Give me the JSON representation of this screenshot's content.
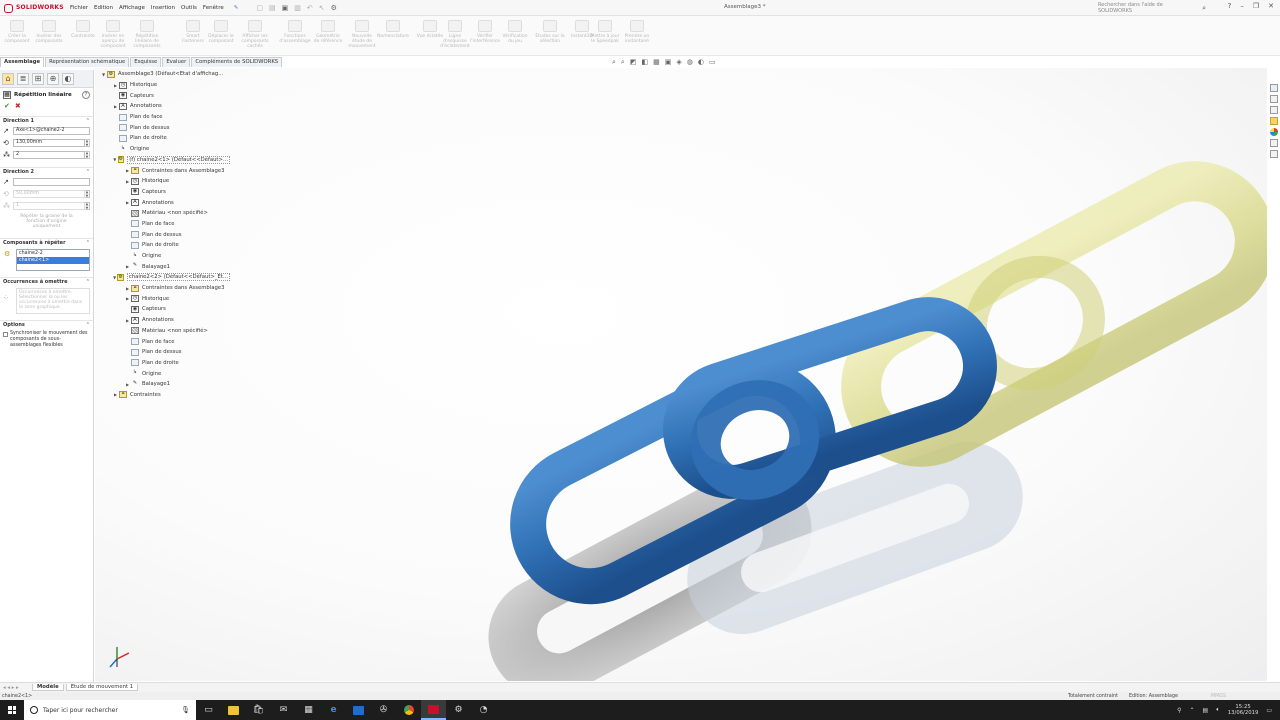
{
  "app": {
    "logo_text": "SOLIDWORKS",
    "menus": [
      "Fichier",
      "Edition",
      "Affichage",
      "Insertion",
      "Outils",
      "Fenêtre"
    ],
    "document_title": "Assemblage3 *",
    "search_placeholder": "Rechercher dans l'aide de SOLIDWORKS"
  },
  "command_manager": [
    "Créer la composant",
    "Insérer des composants",
    "Contrainte",
    "Insérer en aperçu de composant",
    "Répétition linéaire de composants",
    "Smart Fasteners",
    "Déplacer le composant",
    "Afficher les composants cachés",
    "Fonctions d'assemblage",
    "Géométrie de référence",
    "Nouvelle étude de mouvement",
    "Nomenclature",
    "Vue éclatée",
    "Ligne d'esquisse d'éclatement",
    "Vérifier l'interférence",
    "Vérification du jeu",
    "Etudes sur la sélection",
    "Instant3D",
    "Mettre à jour le Speedpak",
    "Prendre un instantané"
  ],
  "ribbon_tabs": [
    "Assemblage",
    "Représentation schématique",
    "Esquisse",
    "Evaluer",
    "Compléments de SOLIDWORKS"
  ],
  "property_manager": {
    "title": "Répétition linéaire",
    "direction1": {
      "heading": "Direction 1",
      "direction_ref": "Axe<1>@chaine2-2",
      "spacing": "130,00mm",
      "instances": "2"
    },
    "direction2": {
      "heading": "Direction 2",
      "direction_ref": "",
      "spacing": "50,00mm",
      "instances": "1",
      "note": "Répéter la graine de la fonction d'origine uniquement"
    },
    "components": {
      "heading": "Composants à répéter",
      "items": [
        "chaine2-2",
        "chaine2<1>"
      ]
    },
    "skip": {
      "heading": "Occurrences à omettre",
      "note": "Occurrences à omettre. Sélectionner la ou les occurrences à omettre dans la zone graphique."
    },
    "options": {
      "heading": "Options",
      "sync_label": "Synchroniser le mouvement des composants de sous-assemblages flexibles"
    }
  },
  "feature_tree": [
    {
      "label": "Assemblage3  (Défaut<Etat d'affichag...",
      "icon": "assembly",
      "expanded": true,
      "level": 0
    },
    {
      "label": "Historique",
      "icon": "history",
      "expander": true,
      "level": 1
    },
    {
      "label": "Capteurs",
      "icon": "sensors",
      "level": 1
    },
    {
      "label": "Annotations",
      "icon": "annotations",
      "expander": true,
      "level": 1
    },
    {
      "label": "Plan de face",
      "icon": "plane",
      "level": 1
    },
    {
      "label": "Plan de dessus",
      "icon": "plane",
      "level": 1
    },
    {
      "label": "Plan de droite",
      "icon": "plane",
      "level": 1
    },
    {
      "label": "Origine",
      "icon": "origin",
      "level": 1
    },
    {
      "label": "(f) chaine2<1> (Défaut<<Défaut>...",
      "icon": "part",
      "expanded": true,
      "boxed": true,
      "level": 1
    },
    {
      "label": "Contraintes dans Assemblage3",
      "icon": "mates",
      "expander": true,
      "level": 2
    },
    {
      "label": "Historique",
      "icon": "history",
      "expander": true,
      "level": 2
    },
    {
      "label": "Capteurs",
      "icon": "sensors",
      "level": 2
    },
    {
      "label": "Annotations",
      "icon": "annotations",
      "expander": true,
      "level": 2
    },
    {
      "label": "Matériau <non spécifié>",
      "icon": "material",
      "level": 2
    },
    {
      "label": "Plan de face",
      "icon": "plane",
      "level": 2
    },
    {
      "label": "Plan de dessus",
      "icon": "plane",
      "level": 2
    },
    {
      "label": "Plan de droite",
      "icon": "plane",
      "level": 2
    },
    {
      "label": "Origine",
      "icon": "origin",
      "level": 2
    },
    {
      "label": "Balayage1",
      "icon": "sweep",
      "expander": true,
      "level": 2
    },
    {
      "label": "chaine2<2> (Défaut<<Défaut>_Et...",
      "icon": "part",
      "expanded": true,
      "boxed": true,
      "level": 1
    },
    {
      "label": "Contraintes dans Assemblage3",
      "icon": "mates",
      "expander": true,
      "level": 2
    },
    {
      "label": "Historique",
      "icon": "history",
      "expander": true,
      "level": 2
    },
    {
      "label": "Capteurs",
      "icon": "sensors",
      "level": 2
    },
    {
      "label": "Annotations",
      "icon": "annotations",
      "expander": true,
      "level": 2
    },
    {
      "label": "Matériau <non spécifié>",
      "icon": "material",
      "level": 2
    },
    {
      "label": "Plan de face",
      "icon": "plane",
      "level": 2
    },
    {
      "label": "Plan de dessus",
      "icon": "plane",
      "level": 2
    },
    {
      "label": "Plan de droite",
      "icon": "plane",
      "level": 2
    },
    {
      "label": "Origine",
      "icon": "origin",
      "level": 2
    },
    {
      "label": "Balayage1",
      "icon": "sweep",
      "expander": true,
      "level": 2
    },
    {
      "label": "Contraintes",
      "icon": "mates",
      "expander": true,
      "level": 1
    }
  ],
  "model_tabs": [
    "Modèle",
    "Etude de mouvement 1"
  ],
  "status": {
    "selection": "chaine2<1>",
    "constraint": "Totalement contraint",
    "mode": "Edition: Assemblage",
    "units": "MMGS"
  },
  "taskbar": {
    "search_placeholder": "Taper ici pour rechercher",
    "time": "15:25",
    "date": "13/06/2019"
  },
  "colors": {
    "link_blue": "#2f6fb4",
    "link_yellow": "#d8d88a",
    "accent_red": "#c8102e",
    "selection_blue": "#3b7ed8"
  }
}
